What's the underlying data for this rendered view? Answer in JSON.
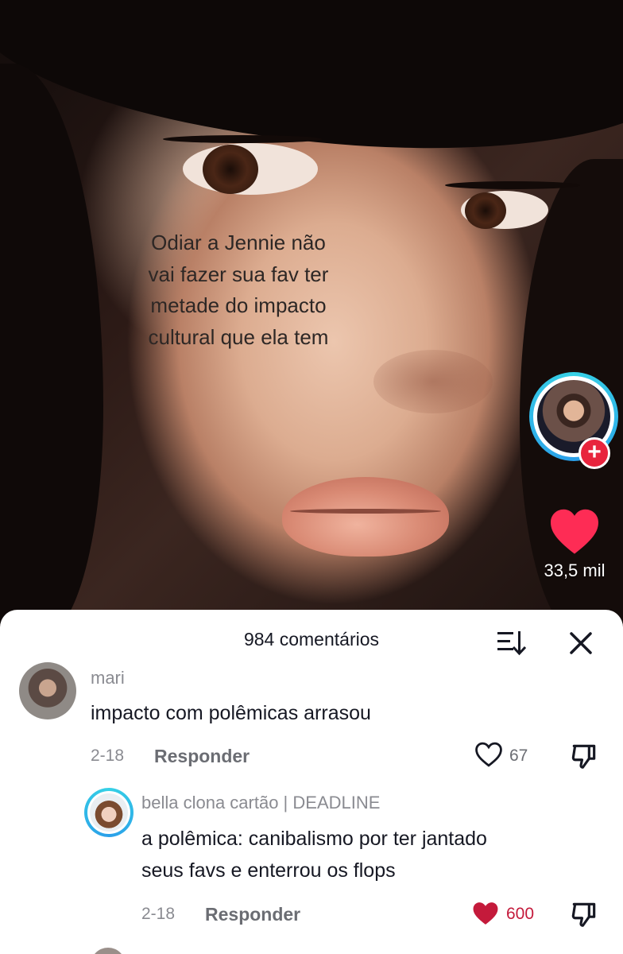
{
  "video": {
    "overlay_text": "Odiar a Jennie não vai fazer sua fav ter metade do impacto cultural que ela tem",
    "like_count": "33,5 mil",
    "follow_symbol": "+"
  },
  "comments_sheet": {
    "title": "984 comentários",
    "comments": [
      {
        "username": "mari",
        "text": "impacto com polêmicas arrasou",
        "date": "2-18",
        "reply_label": "Responder",
        "likes": "67",
        "liked": false
      }
    ],
    "replies": [
      {
        "username": "bella clona cartão | DEADLINE",
        "text_line1": "a polêmica: canibalismo por ter jantado",
        "text_line2": "seus favs e enterrou os flops",
        "date": "2-18",
        "reply_label": "Responder",
        "likes": "600",
        "liked": true
      }
    ]
  },
  "colors": {
    "like_red": "#e8243d",
    "liked_heart": "#c41a3b",
    "ring_cyan": "#36d1e6"
  }
}
